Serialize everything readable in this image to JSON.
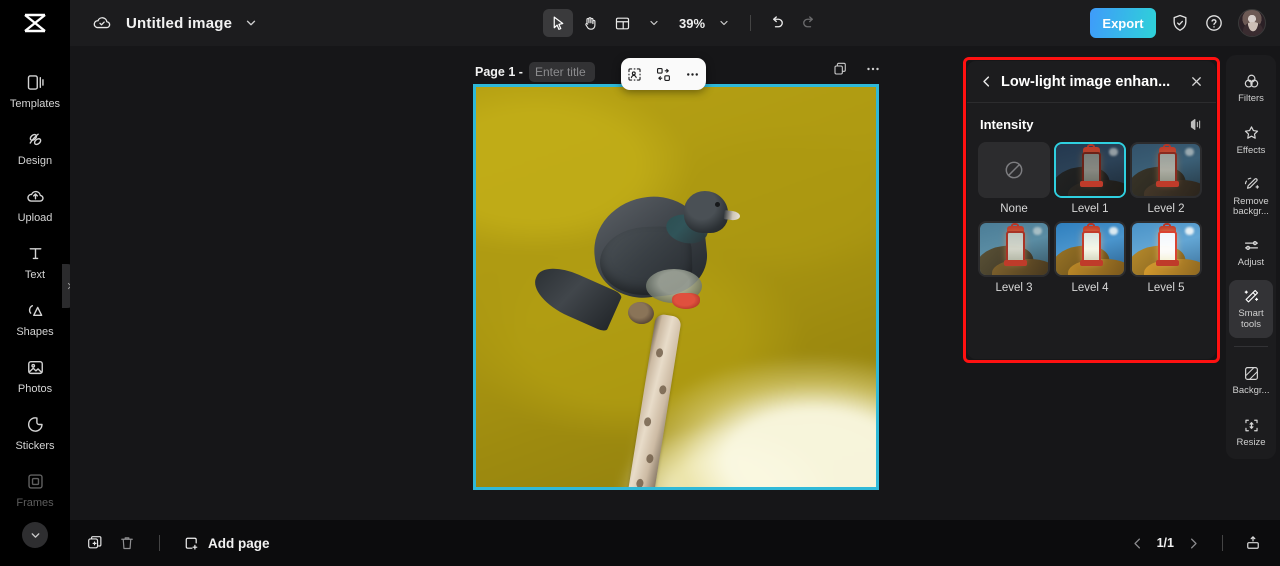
{
  "app": {
    "brand_icon": "capcut-logo-icon",
    "document_title": "Untitled image",
    "cloud_status_icon": "cloud-saved-icon"
  },
  "topbar": {
    "select_tool_icon": "cursor-arrow-icon",
    "hand_tool_icon": "hand-icon",
    "layout_tool_icon": "layout-panel-icon",
    "zoom_value": "39%",
    "undo_icon": "undo-icon",
    "redo_icon": "redo-icon",
    "export_label": "Export",
    "shield_icon": "shield-check-icon",
    "help_icon": "question-circle-icon",
    "avatar_icon": "user-avatar"
  },
  "left_rail": {
    "items": [
      {
        "label": "Templates",
        "icon": "templates-icon",
        "dim": false
      },
      {
        "label": "Design",
        "icon": "design-icon",
        "dim": false
      },
      {
        "label": "Upload",
        "icon": "upload-cloud-icon",
        "dim": false
      },
      {
        "label": "Text",
        "icon": "text-icon",
        "dim": false
      },
      {
        "label": "Shapes",
        "icon": "shapes-icon",
        "dim": false
      },
      {
        "label": "Photos",
        "icon": "photos-icon",
        "dim": false
      },
      {
        "label": "Stickers",
        "icon": "stickers-icon",
        "dim": false
      },
      {
        "label": "Frames",
        "icon": "frames-icon",
        "dim": true
      }
    ],
    "more_icon": "chevron-down-icon",
    "expand_handle_icon": "chevron-right-icon"
  },
  "canvas": {
    "page_label": "Page 1 -",
    "page_title_value": "",
    "page_title_placeholder": "Enter title",
    "duplicate_page_icon": "duplicate-page-icon",
    "page_more_icon": "ellipsis-icon",
    "float_toolbar": {
      "cutout_icon": "cutout-icon",
      "replace_icon": "replace-image-icon",
      "more_icon": "ellipsis-icon"
    },
    "artwork": {
      "description": "Pigeon perched on a bare branch against a blurred olive-yellow background",
      "border_color": "#2fb9d8"
    }
  },
  "panel": {
    "highlight_color": "#ff1111",
    "back_icon": "chevron-left-icon",
    "title": "Low-light image enhan...",
    "close_icon": "close-icon",
    "section_label": "Intensity",
    "compare_icon": "compare-before-after-icon",
    "options": [
      {
        "label": "None",
        "type": "none",
        "selected": false
      },
      {
        "label": "Level 1",
        "type": "preview",
        "selected": true,
        "brightness": 0.42,
        "sky": "#2b3a4a",
        "rock": "#2a2a26"
      },
      {
        "label": "Level 2",
        "type": "preview",
        "selected": false,
        "brightness": 0.56,
        "sky": "#3a5566",
        "rock": "#4a4436"
      },
      {
        "label": "Level 3",
        "type": "preview",
        "selected": false,
        "brightness": 0.7,
        "sky": "#53788c",
        "rock": "#70603d"
      },
      {
        "label": "Level 4",
        "type": "preview",
        "selected": false,
        "brightness": 0.85,
        "sky": "#3f86bd",
        "rock": "#a07a2c"
      },
      {
        "label": "Level 5",
        "type": "preview",
        "selected": false,
        "brightness": 1.0,
        "sky": "#4f94c9",
        "rock": "#c38d2c"
      }
    ],
    "none_icon": "no-effect-icon"
  },
  "right_rail": {
    "items": [
      {
        "label": "Filters",
        "icon": "filters-icon",
        "active": false
      },
      {
        "label": "Effects",
        "icon": "effects-icon",
        "active": false
      },
      {
        "label": "Remove backgr...",
        "icon": "remove-background-icon",
        "active": false
      },
      {
        "label": "Adjust",
        "icon": "adjust-sliders-icon",
        "active": false
      },
      {
        "label": "Smart tools",
        "icon": "smart-tools-icon",
        "active": true
      },
      {
        "label": "Backgr...",
        "icon": "background-icon",
        "active": false
      },
      {
        "label": "Resize",
        "icon": "resize-icon",
        "active": false
      }
    ]
  },
  "bottombar": {
    "duplicate_icon": "duplicate-icon",
    "delete_icon": "trash-icon",
    "add_page_label": "Add page",
    "add_page_icon": "add-page-icon",
    "prev_icon": "chevron-left-icon",
    "page_indicator": "1/1",
    "next_icon": "chevron-right-icon",
    "export_tray_icon": "export-tray-icon"
  }
}
